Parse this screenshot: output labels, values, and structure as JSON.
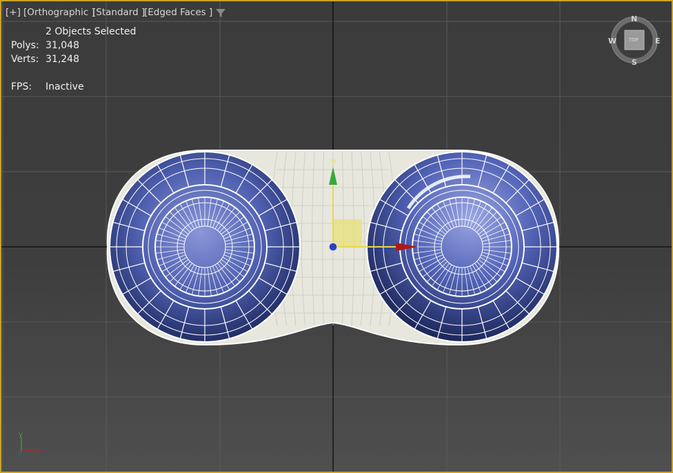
{
  "viewport_label": {
    "plus": "[+]",
    "view": "[Orthographic ]",
    "shading": "[Standard ]",
    "style": "[Edged Faces ]"
  },
  "stats": {
    "selection": "2 Objects Selected",
    "polys_label": "Polys:",
    "polys_value": "31,048",
    "verts_label": "Verts:",
    "verts_value": "31,248",
    "fps_label": "FPS:",
    "fps_value": "Inactive"
  },
  "viewcube": {
    "north": "N",
    "south": "S",
    "east": "E",
    "west": "W",
    "face": "TOP"
  },
  "gizmo": {
    "y_axis_label": "y"
  },
  "axis_tripod": {
    "y_label": "y",
    "z_label": "z",
    "x_label": "x"
  },
  "colors": {
    "active_border": "#c9a227",
    "wire": "#ffffff",
    "tire_blue": "#5566b0",
    "body_fill": "#e7e7de",
    "gizmo_y": "#3aa83a",
    "gizmo_x": "#b01818",
    "gizmo_plane": "#e8e07a",
    "gizmo_center": "#2940c0"
  }
}
